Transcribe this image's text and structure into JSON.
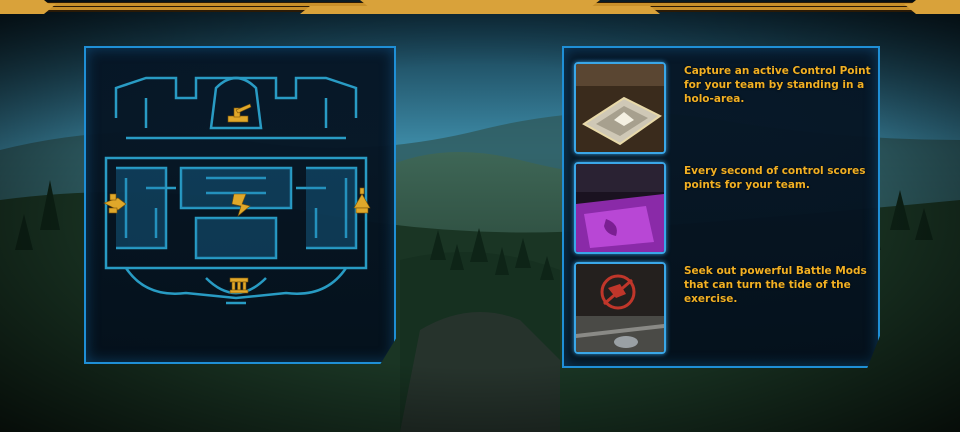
{
  "map": {
    "objectives": [
      {
        "name": "left-turret-objective",
        "icon": "turret-icon"
      },
      {
        "name": "top-cannon-objective",
        "icon": "cannon-icon"
      },
      {
        "name": "center-objective",
        "icon": "objective-glyph-icon"
      },
      {
        "name": "right-objective",
        "icon": "pyramid-icon"
      },
      {
        "name": "bottom-gate-objective",
        "icon": "gate-icon"
      }
    ]
  },
  "tips": [
    {
      "text": "Capture an active Control Point for your team by standing in a holo-area.",
      "image": "control-point-holo-area"
    },
    {
      "text": "Every second of control scores points for your team.",
      "image": "purple-control-zone"
    },
    {
      "text": "Seek out powerful Battle Mods that can turn the tide of the exercise.",
      "image": "battle-mod-emblem"
    }
  ],
  "colors": {
    "accent_text": "#f2b023",
    "panel_border": "#1f8fd6",
    "frame_gold": "#c8902a"
  }
}
